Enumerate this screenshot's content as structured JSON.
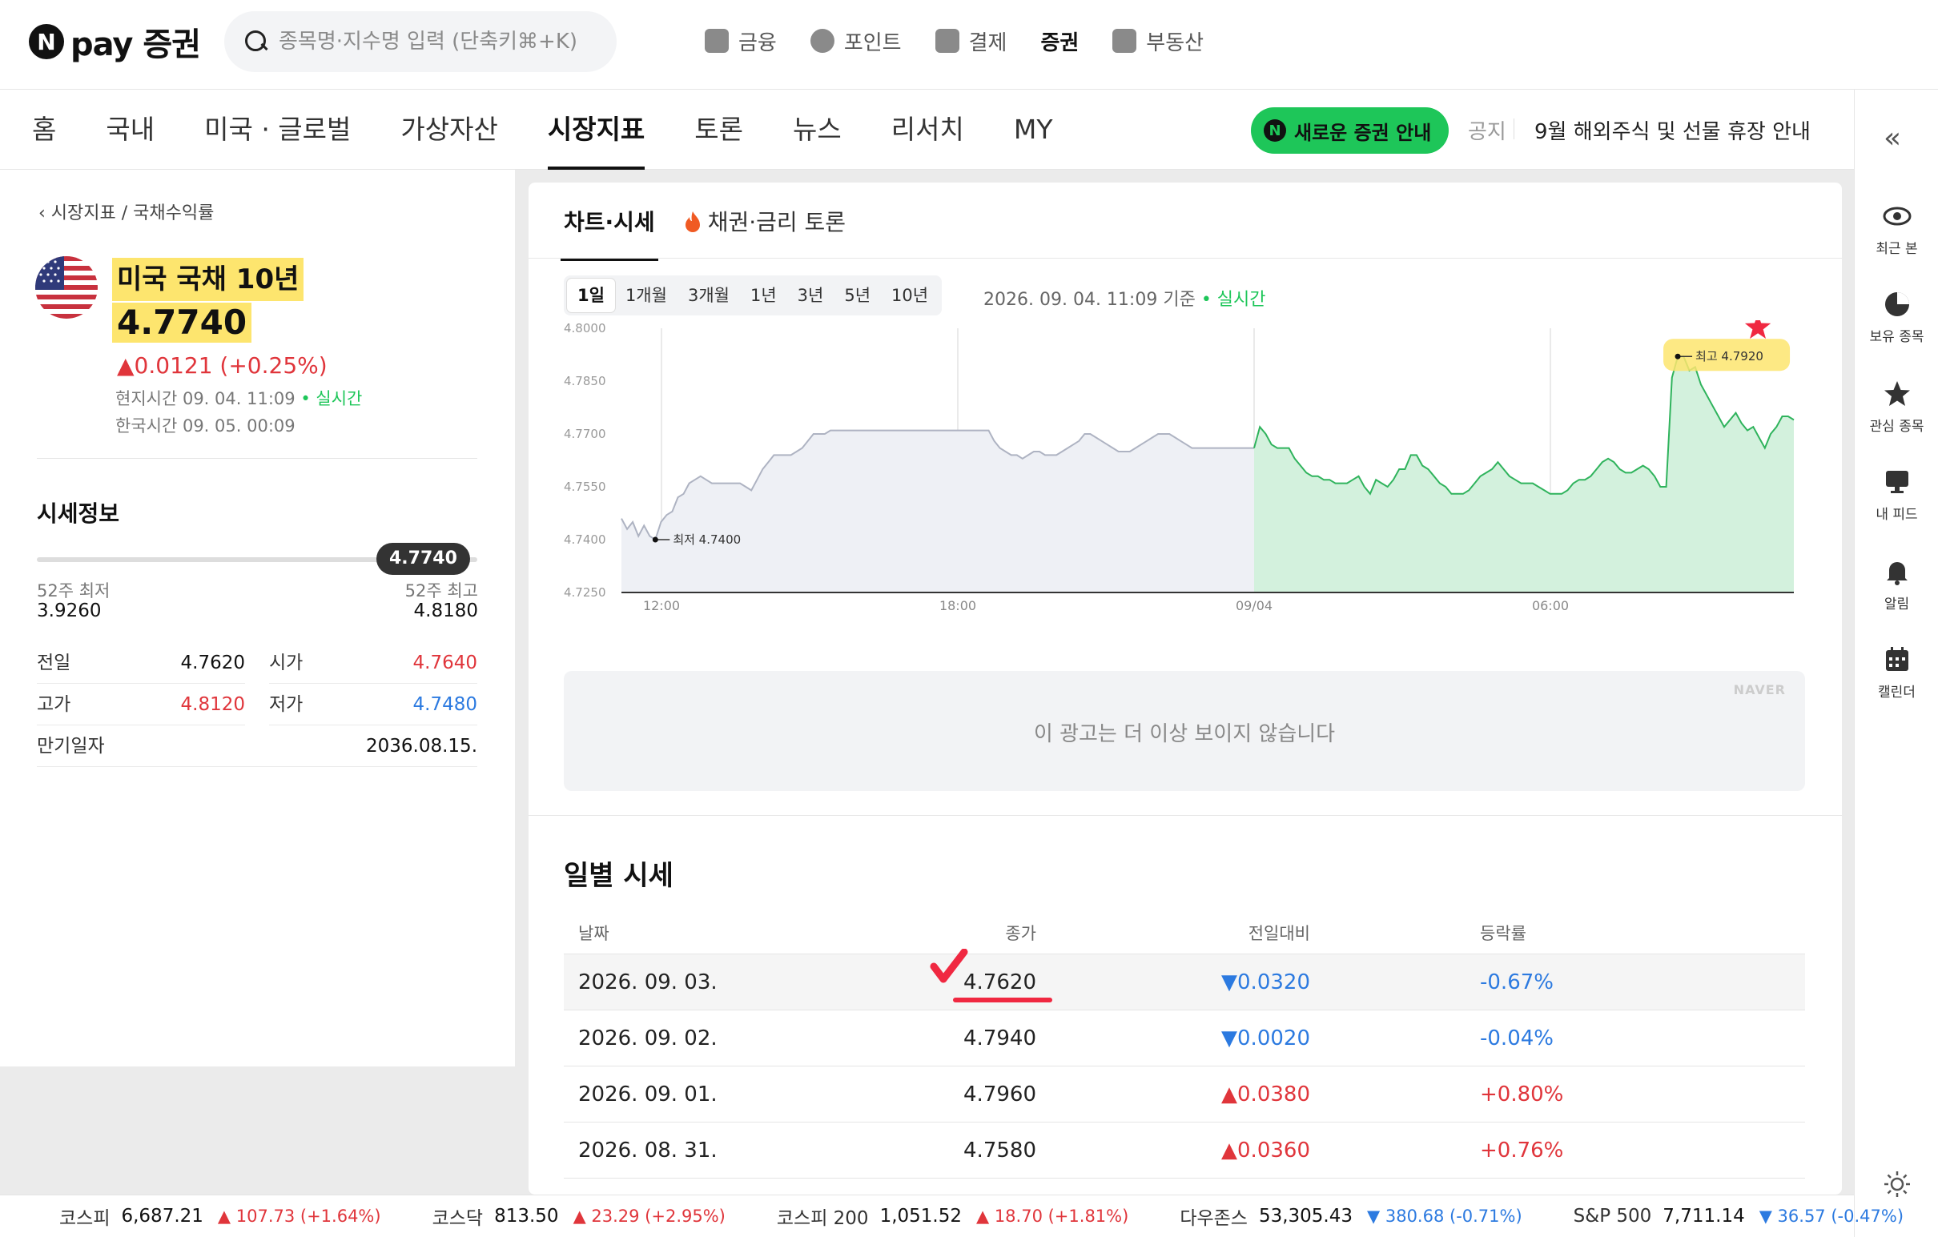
{
  "logo": {
    "n": "N",
    "text": "pay 증권"
  },
  "search": {
    "placeholder": "종목명·지수명 입력 (단축키⌘+K)"
  },
  "services": [
    {
      "label": "금융",
      "icon": "wallet-icon"
    },
    {
      "label": "포인트",
      "icon": "point-coin-icon"
    },
    {
      "label": "결제",
      "icon": "receipt-icon"
    },
    {
      "label": "증권",
      "icon": "stock-chart-icon"
    },
    {
      "label": "부동산",
      "icon": "building-icon"
    }
  ],
  "nav": {
    "tabs": [
      "홈",
      "국내",
      "미국 · 글로벌",
      "가상자산",
      "시장지표",
      "토론",
      "뉴스",
      "리서치",
      "MY"
    ],
    "active": "시장지표",
    "pill": {
      "n": "N",
      "label": "새로운 증권 안내"
    },
    "notice_label": "공지",
    "notice_text": "9월 해외주식 및 선물 휴장 안내"
  },
  "sidebar_right": {
    "items": [
      {
        "label": "최근 본",
        "icon": "eye-icon"
      },
      {
        "label": "보유 종목",
        "icon": "pie-chart-icon"
      },
      {
        "label": "관심 종목",
        "icon": "star-icon"
      },
      {
        "label": "내 피드",
        "icon": "monitor-icon"
      },
      {
        "label": "알림",
        "icon": "bell-icon"
      },
      {
        "label": "캘린더",
        "icon": "calendar-icon"
      }
    ]
  },
  "instrument": {
    "breadcrumb": "시장지표 / 국채수익률",
    "title": "미국 국채 10년",
    "price": "4.7740",
    "change": "▲0.0121 (+0.25%)",
    "local_time": "현지시간 09. 04. 11:09",
    "realtime": "• 실시간",
    "korea_time": "한국시간 09. 05. 00:09"
  },
  "quote_info": {
    "title": "시세정보",
    "range_badge": "4.7740",
    "range_position": 0.88,
    "low52_label": "52주 최저",
    "low52": "3.9260",
    "high52_label": "52주 최고",
    "high52": "4.8180",
    "rows": [
      [
        {
          "label": "전일",
          "value": "4.7620",
          "color": ""
        },
        {
          "label": "시가",
          "value": "4.7640",
          "color": "red"
        }
      ],
      [
        {
          "label": "고가",
          "value": "4.8120",
          "color": "red"
        },
        {
          "label": "저가",
          "value": "4.7480",
          "color": "blue"
        }
      ],
      [
        {
          "label": "만기일자",
          "value": "2036.08.15.",
          "color": ""
        }
      ]
    ]
  },
  "chart_tabs": [
    "차트·시세",
    "채권·금리 토론"
  ],
  "periods": [
    "1일",
    "1개월",
    "3개월",
    "1년",
    "3년",
    "5년",
    "10년"
  ],
  "active_period": "1일",
  "asof": "2026. 09. 04. 11:09 기준",
  "asof_realtime": "• 실시간",
  "chart_data": {
    "type": "area",
    "x_ticks": [
      "12:00",
      "18:00",
      "09/04",
      "06:00"
    ],
    "ylim": [
      4.725,
      4.8
    ],
    "y_ticks": [
      "4.8000",
      "4.7850",
      "4.7700",
      "4.7550",
      "4.7400",
      "4.7250"
    ],
    "min_label": "최저 4.7400",
    "max_label": "최고 4.7920",
    "prev_session": [
      4.746,
      4.743,
      4.745,
      4.741,
      4.744,
      4.741,
      4.74,
      4.745,
      4.747,
      4.748,
      4.752,
      4.753,
      4.756,
      4.757,
      4.758,
      4.757,
      4.756,
      4.756,
      4.756,
      4.756,
      4.756,
      4.756,
      4.755,
      4.754,
      4.757,
      4.76,
      4.762,
      4.764,
      4.764,
      4.764,
      4.764,
      4.765,
      4.766,
      4.768,
      4.77,
      4.77,
      4.77,
      4.771,
      4.771,
      4.771,
      4.771,
      4.771,
      4.771,
      4.771,
      4.771,
      4.771,
      4.771,
      4.771,
      4.771,
      4.771,
      4.771,
      4.771,
      4.771,
      4.771,
      4.771,
      4.771,
      4.771,
      4.771,
      4.771,
      4.771,
      4.771,
      4.771,
      4.771,
      4.771,
      4.771,
      4.771,
      4.768,
      4.766,
      4.765,
      4.764,
      4.764,
      4.763,
      4.764,
      4.765,
      4.765,
      4.764,
      4.764,
      4.764,
      4.765,
      4.766,
      4.767,
      4.768,
      4.77,
      4.77,
      4.769,
      4.768,
      4.767,
      4.766,
      4.765,
      4.765,
      4.765,
      4.766,
      4.767,
      4.768,
      4.769,
      4.77,
      4.77,
      4.77,
      4.769,
      4.768,
      4.767,
      4.766,
      4.766,
      4.766,
      4.766,
      4.766,
      4.766,
      4.766,
      4.766,
      4.766,
      4.766,
      4.766,
      4.766
    ],
    "curr_session": [
      4.766,
      4.772,
      4.77,
      4.767,
      4.766,
      4.766,
      4.766,
      4.763,
      4.761,
      4.759,
      4.758,
      4.758,
      4.757,
      4.757,
      4.756,
      4.756,
      4.756,
      4.757,
      4.758,
      4.755,
      4.753,
      4.757,
      4.756,
      4.755,
      4.757,
      4.76,
      4.76,
      4.764,
      4.764,
      4.761,
      4.76,
      4.758,
      4.756,
      4.755,
      4.753,
      4.753,
      4.753,
      4.754,
      4.756,
      4.758,
      4.759,
      4.76,
      4.762,
      4.76,
      4.758,
      4.757,
      4.756,
      4.756,
      4.756,
      4.755,
      4.754,
      4.753,
      4.753,
      4.753,
      4.754,
      4.756,
      4.757,
      4.757,
      4.758,
      4.76,
      4.762,
      4.763,
      4.762,
      4.76,
      4.759,
      4.759,
      4.76,
      4.761,
      4.76,
      4.758,
      4.755,
      4.755,
      4.786,
      4.792,
      4.792,
      4.788,
      4.789,
      4.784,
      4.781,
      4.778,
      4.775,
      4.772,
      4.774,
      4.776,
      4.773,
      4.771,
      4.772,
      4.769,
      4.766,
      4.77,
      4.772,
      4.775,
      4.775,
      4.774
    ]
  },
  "ad": {
    "text": "이 광고는 더 이상 보이지 않습니다",
    "brand": "NAVER"
  },
  "daily": {
    "title": "일별 시세",
    "headers": {
      "date": "날짜",
      "close": "종가",
      "diff": "전일대비",
      "rate": "등락률"
    },
    "rows": [
      {
        "date": "2026. 09. 03.",
        "close": "4.7620",
        "diff": "▼0.0320",
        "rate": "-0.67%",
        "dir": "down"
      },
      {
        "date": "2026. 09. 02.",
        "close": "4.7940",
        "diff": "▼0.0020",
        "rate": "-0.04%",
        "dir": "down"
      },
      {
        "date": "2026. 09. 01.",
        "close": "4.7960",
        "diff": "▲0.0380",
        "rate": "+0.80%",
        "dir": "up"
      },
      {
        "date": "2026. 08. 31.",
        "close": "4.7580",
        "diff": "▲0.0360",
        "rate": "+0.76%",
        "dir": "up"
      }
    ]
  },
  "ticker": [
    {
      "name": "코스피",
      "value": "6,687.21",
      "change": "▲ 107.73 (+1.64%)",
      "dir": "up"
    },
    {
      "name": "코스닥",
      "value": "813.50",
      "change": "▲ 23.29 (+2.95%)",
      "dir": "up"
    },
    {
      "name": "코스피 200",
      "value": "1,051.52",
      "change": "▲ 18.70 (+1.81%)",
      "dir": "up"
    },
    {
      "name": "다우존스",
      "value": "53,305.43",
      "change": "▼ 380.68 (-0.71%)",
      "dir": "down"
    },
    {
      "name": "S&P 500",
      "value": "7,711.14",
      "change": "▼ 36.57 (-0.47%)",
      "dir": "down"
    }
  ],
  "colors": {
    "brand_green": "#1ec659",
    "up_red": "#e0353b",
    "down_blue": "#2c7ae0",
    "highlight": "#fde56e",
    "annotation_red": "#f02841"
  }
}
